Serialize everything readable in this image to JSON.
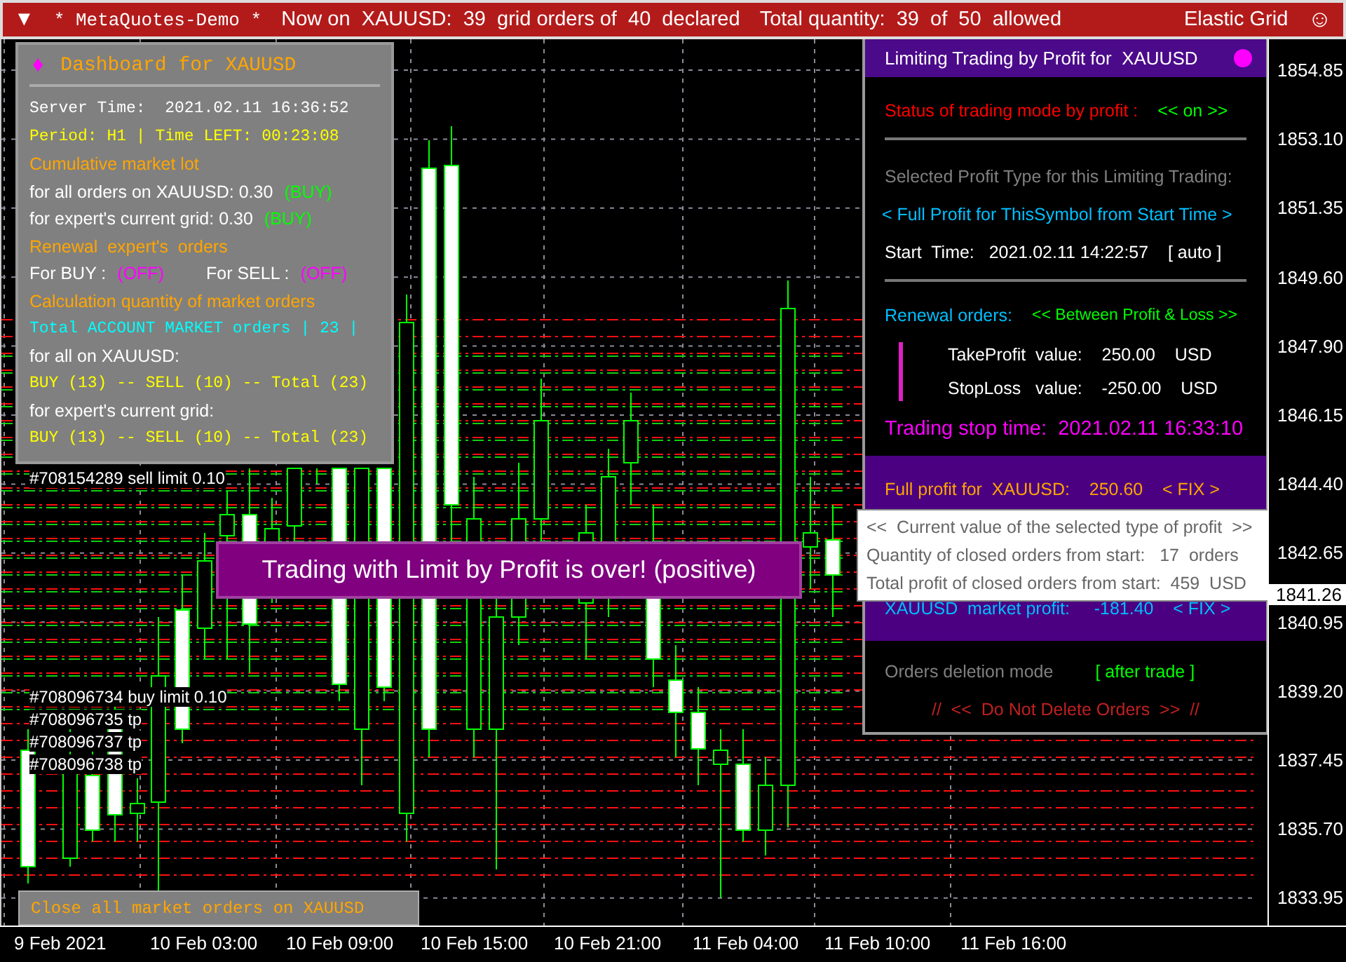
{
  "top_bar": {
    "menu_glyph": "▼",
    "account": "* MetaQuotes-Demo *",
    "grid_status": "Now on  XAUUSD:  39  grid orders of  40  declared",
    "quantity": "Total quantity:  39  of  50  allowed",
    "expert": "Elastic Grid",
    "smiley": "☺"
  },
  "dashboard": {
    "glyph": "♦",
    "title": "Dashboard for XAUUSD",
    "lines": [
      {
        "kind": "mono",
        "parts": [
          {
            "text": "Server Time:  2021.02.11 16:36:52",
            "color": "#ffffff"
          }
        ]
      },
      {
        "kind": "mono",
        "parts": [
          {
            "text": "Period: H1 | Time LEFT: 00:23:08",
            "color": "#ffff00"
          }
        ]
      },
      {
        "kind": "sans",
        "parts": [
          {
            "text": "Cumulative market lot",
            "color": "#ffa500"
          }
        ]
      },
      {
        "kind": "sans",
        "parts": [
          {
            "text": "for all orders on XAUUSD: 0.30",
            "color": "#ffffff"
          },
          {
            "text": "(BUY)",
            "color": "#00ff00"
          }
        ]
      },
      {
        "kind": "sans",
        "parts": [
          {
            "text": "for expert's current grid: 0.30",
            "color": "#ffffff"
          },
          {
            "text": "(BUY)",
            "color": "#00ff00"
          }
        ]
      },
      {
        "kind": "sans",
        "parts": [
          {
            "text": "Renewal  expert's  orders",
            "color": "#ffa500"
          }
        ]
      },
      {
        "kind": "sans",
        "parts": [
          {
            "text": "For BUY :",
            "color": "#ffffff"
          },
          {
            "text": "(OFF)",
            "color": "#ff00ff"
          },
          {
            "text": "For SELL :",
            "color": "#ffffff"
          },
          {
            "text": "(OFF)",
            "color": "#ff00ff"
          }
        ]
      },
      {
        "kind": "sans",
        "parts": [
          {
            "text": "Calculation quantity of market orders",
            "color": "#ffa500"
          }
        ]
      },
      {
        "kind": "mono",
        "parts": [
          {
            "text": "Total ACCOUNT MARKET orders | 23 |",
            "color": "#00ffff"
          }
        ]
      },
      {
        "kind": "sans",
        "parts": [
          {
            "text": "for all on XAUUSD:",
            "color": "#ffffff"
          }
        ]
      },
      {
        "kind": "mono",
        "parts": [
          {
            "text": "BUY (13) -- SELL (10) -- Total (23)",
            "color": "#ffff00"
          }
        ]
      },
      {
        "kind": "sans",
        "parts": [
          {
            "text": "for expert's current grid:",
            "color": "#ffffff"
          }
        ]
      },
      {
        "kind": "mono",
        "parts": [
          {
            "text": "BUY (13) -- SELL (10) -- Total (23)",
            "color": "#ffff00"
          }
        ]
      }
    ]
  },
  "close_button": "Close all market orders on XAUUSD",
  "order_labels": [
    "#708154289 sell limit 0.10",
    "#708096734 buy limit 0.10",
    "#708096735 tp",
    "#708096737 tp",
    "#708096738 tp"
  ],
  "banner": "Trading with Limit by Profit is over! (positive)",
  "profit_panel": {
    "title": "Limiting Trading by Profit for  XAUUSD",
    "status": [
      {
        "text": "Status of trading mode by profit :",
        "color": "#ff0000"
      },
      {
        "text": "<< on >>",
        "color": "#00ff00"
      }
    ],
    "profit_type_label": "Selected Profit Type for this Limiting Trading:",
    "profit_type": "< Full Profit for ThisSymbol from Start Time >",
    "start_time": "Start  Time:   2021.02.11 14:22:57    [ auto ]",
    "renewal": [
      {
        "text": "Renewal orders:",
        "color": "#00bfff"
      },
      {
        "text": "<< Between Profit & Loss >>",
        "color": "#00ff00"
      }
    ],
    "levels": [
      "TakeProfit  value:    250.00    USD",
      "StopLoss   value:    -250.00    USD"
    ],
    "stop_time": "Trading stop time:  2021.02.11 16:33:10",
    "profits": [
      {
        "text": "Full profit for  XAUUSD:    250.60    < FIX >",
        "color": "#ffa500"
      },
      {
        "text": "XAUUSD  market profit:     -181.40    < FIX >",
        "color": "#00bfff"
      }
    ],
    "deletion": [
      {
        "text": "Orders deletion mode",
        "color": "#808080"
      },
      {
        "text": "[ after trade ]",
        "color": "#00ff00"
      }
    ],
    "deletion_rule": "//  <<  Do Not Delete Orders  >>  //"
  },
  "tooltip": [
    "<<  Current value of the selected type of profit  >>",
    "Quantity of closed orders from start:   17  orders",
    "Total profit of closed orders from start:  459  USD"
  ],
  "price_axis": [
    "1854.85",
    "1853.10",
    "1851.35",
    "1849.60",
    "1847.90",
    "1846.15",
    "1844.40",
    "1842.65",
    "1840.95",
    "1839.20",
    "1837.45",
    "1835.70",
    "1833.95"
  ],
  "current_price": "1841.26",
  "time_axis": [
    "9 Feb 2021",
    "10 Feb 03:00",
    "10 Feb 09:00",
    "10 Feb 15:00",
    "10 Feb 21:00",
    "11 Feb 04:00",
    "11 Feb 10:00",
    "11 Feb 16:00"
  ]
}
